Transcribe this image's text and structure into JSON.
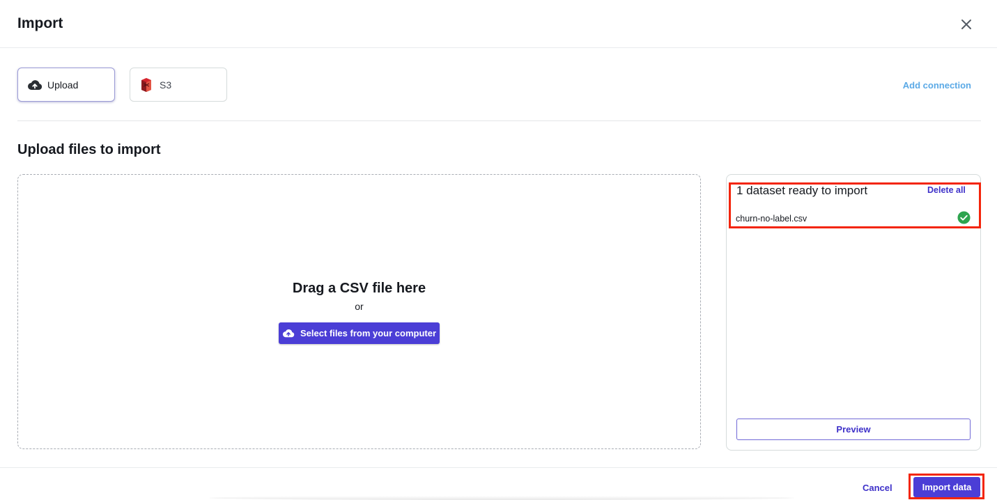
{
  "header": {
    "title": "Import",
    "close_icon": "close-icon"
  },
  "sources": {
    "tabs": [
      {
        "label": "Upload",
        "icon": "cloud-upload-icon",
        "selected": true
      },
      {
        "label": "S3",
        "icon": "s3-bucket-icon",
        "selected": false
      }
    ],
    "add_connection_label": "Add connection"
  },
  "upload": {
    "section_title": "Upload files to import",
    "drop_title": "Drag a CSV file here",
    "drop_or": "or",
    "select_button_label": "Select files from your computer"
  },
  "ready_panel": {
    "title": "1 dataset ready to import",
    "delete_all_label": "Delete all",
    "files": [
      {
        "name": "churn-no-label.csv",
        "status_icon": "check-circle-icon"
      }
    ],
    "preview_label": "Preview"
  },
  "footer": {
    "cancel_label": "Cancel",
    "import_label": "Import data"
  },
  "colors": {
    "primary": "#4b3ed6",
    "link": "#3e31c9",
    "add_connection": "#5aa9e6",
    "success": "#2ea44f",
    "highlight": "#f3250b",
    "s3_brand": "#d6242d"
  }
}
